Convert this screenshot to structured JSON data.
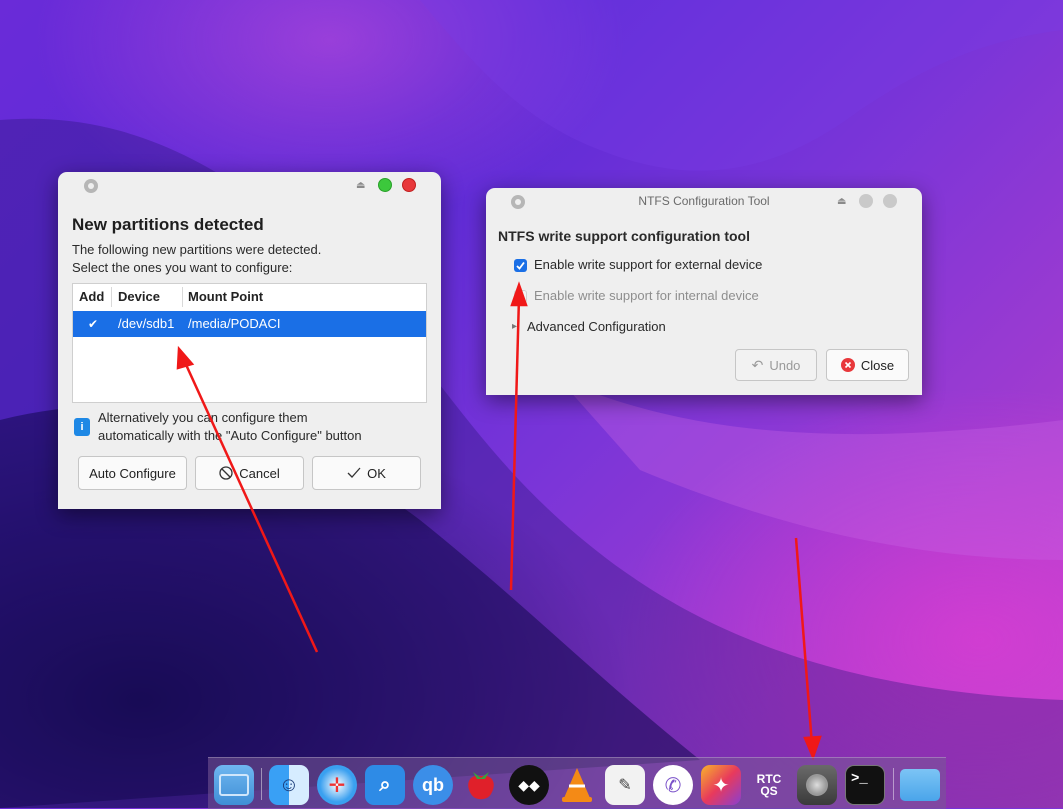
{
  "dialog_partitions": {
    "heading": "New partitions detected",
    "desc_line1": "The following new partitions were detected.",
    "desc_line2": "Select the ones you want to configure:",
    "columns": [
      "Add",
      "Device",
      "Mount Point"
    ],
    "rows": [
      {
        "checked": true,
        "check_glyph": "✔",
        "device": "/dev/sdb1",
        "mount_point": "/media/PODACI"
      }
    ],
    "info_line1": "Alternatively you can configure them",
    "info_line2": "automatically with the \"Auto Configure\" button",
    "auto_configure_label": "Auto Configure",
    "cancel_label": "Cancel",
    "ok_label": "OK"
  },
  "dialog_ntfs": {
    "title": "NTFS Configuration Tool",
    "heading": "NTFS write support configuration tool",
    "external_label": "Enable write support for external device",
    "external_checked": true,
    "internal_label": "Enable write support for internal device",
    "internal_checked": false,
    "advanced_label": "Advanced Configuration",
    "undo_label": "Undo",
    "close_label": "Close"
  },
  "dock": {
    "items": [
      {
        "name": "files-icon"
      },
      {
        "name": "finder-icon"
      },
      {
        "name": "safari-icon"
      },
      {
        "name": "search-icon"
      },
      {
        "name": "qbittorrent-icon",
        "text": "qb"
      },
      {
        "name": "strawberry-icon"
      },
      {
        "name": "tidal-icon"
      },
      {
        "name": "vlc-icon"
      },
      {
        "name": "text-editor-icon"
      },
      {
        "name": "viber-icon"
      },
      {
        "name": "app-launcher-icon"
      },
      {
        "name": "rtcqs-icon",
        "text": "RTC QS"
      },
      {
        "name": "disk-utility-icon"
      },
      {
        "name": "terminal-icon",
        "text": ">_"
      },
      {
        "name": "folder-icon"
      }
    ]
  },
  "colors": {
    "accent": "#1a6fe6",
    "close_red": "#e8383b",
    "maximize_green": "#3cc83c",
    "arrow": "#f01818"
  }
}
